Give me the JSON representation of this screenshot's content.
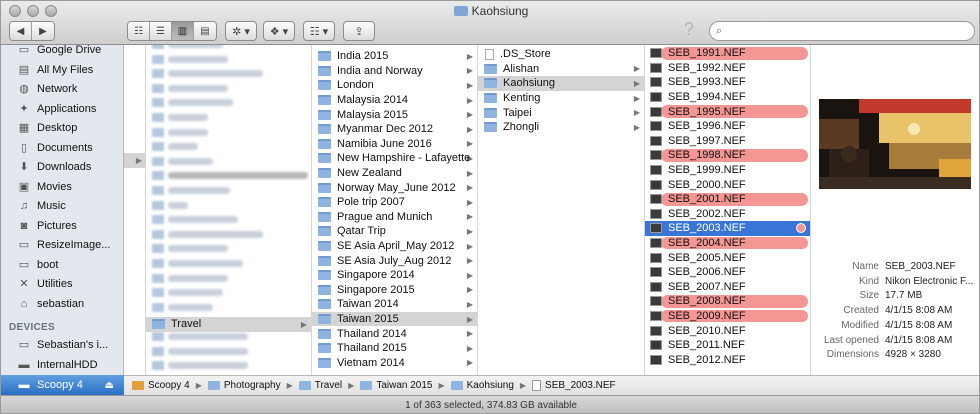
{
  "window": {
    "title": "Kaohsiung"
  },
  "toolbar": {
    "back": "◀",
    "forward": "▶",
    "view_icons": "☷",
    "view_list": "☰",
    "view_columns": "▥",
    "view_cover": "▤",
    "action": "✲ ▾",
    "dropbox": "❖ ▾",
    "arrange": "☷ ▾",
    "share": "⇪",
    "help": "?",
    "search_placeholder": ""
  },
  "sidebar": {
    "items": [
      {
        "label": "Google Drive",
        "icon": "folder-icon"
      },
      {
        "label": "All My Files",
        "icon": "files-icon"
      },
      {
        "label": "Network",
        "icon": "globe-icon"
      },
      {
        "label": "Applications",
        "icon": "applications-icon"
      },
      {
        "label": "Desktop",
        "icon": "desktop-icon"
      },
      {
        "label": "Documents",
        "icon": "documents-icon"
      },
      {
        "label": "Downloads",
        "icon": "downloads-icon"
      },
      {
        "label": "Movies",
        "icon": "movies-icon"
      },
      {
        "label": "Music",
        "icon": "music-icon"
      },
      {
        "label": "Pictures",
        "icon": "camera-icon"
      },
      {
        "label": "ResizeImage...",
        "icon": "folder-icon"
      },
      {
        "label": "boot",
        "icon": "folder-icon"
      },
      {
        "label": "Utilities",
        "icon": "utilities-icon"
      },
      {
        "label": "sebastian",
        "icon": "home-icon"
      }
    ],
    "devices_heading": "DEVICES",
    "devices": [
      {
        "label": "Sebastian's i...",
        "icon": "computer-icon"
      },
      {
        "label": "InternalHDD",
        "icon": "drive-icon"
      },
      {
        "label": "Scoopy 4",
        "icon": "external-drive-icon",
        "eject": "⏏"
      }
    ]
  },
  "columns": {
    "col2_selected": "Travel",
    "col3": [
      "India 2015",
      "India and Norway",
      "London",
      "Malaysia 2014",
      "Malaysia 2015",
      "Myanmar Dec 2012",
      "Namibia June 2016",
      "New Hampshire - Lafayette",
      "New Zealand",
      "Norway May_June 2012",
      "Pole trip 2007",
      "Prague and Munich",
      "Qatar Trip",
      "SE Asia April_May 2012",
      "SE Asia July_Aug 2012",
      "Singapore 2014",
      "Singapore 2015",
      "Taiwan 2014",
      "Taiwan 2015",
      "Thailand 2014",
      "Thailand 2015",
      "Vietnam 2014"
    ],
    "col3_selected": "Taiwan 2015",
    "col4": [
      ".DS_Store",
      "Alishan",
      "Kaohsiung",
      "Kenting",
      "Taipei",
      "Zhongli"
    ],
    "col4_selected": "Kaohsiung",
    "col5": [
      {
        "name": "SEB_1991.NEF",
        "tag": "red"
      },
      {
        "name": "SEB_1992.NEF",
        "tag": ""
      },
      {
        "name": "SEB_1993.NEF",
        "tag": ""
      },
      {
        "name": "SEB_1994.NEF",
        "tag": ""
      },
      {
        "name": "SEB_1995.NEF",
        "tag": "red"
      },
      {
        "name": "SEB_1996.NEF",
        "tag": ""
      },
      {
        "name": "SEB_1997.NEF",
        "tag": ""
      },
      {
        "name": "SEB_1998.NEF",
        "tag": "red"
      },
      {
        "name": "SEB_1999.NEF",
        "tag": ""
      },
      {
        "name": "SEB_2000.NEF",
        "tag": ""
      },
      {
        "name": "SEB_2001.NEF",
        "tag": "red"
      },
      {
        "name": "SEB_2002.NEF",
        "tag": ""
      },
      {
        "name": "SEB_2003.NEF",
        "tag": "selected"
      },
      {
        "name": "SEB_2004.NEF",
        "tag": "red"
      },
      {
        "name": "SEB_2005.NEF",
        "tag": ""
      },
      {
        "name": "SEB_2006.NEF",
        "tag": ""
      },
      {
        "name": "SEB_2007.NEF",
        "tag": ""
      },
      {
        "name": "SEB_2008.NEF",
        "tag": "red"
      },
      {
        "name": "SEB_2009.NEF",
        "tag": "red"
      },
      {
        "name": "SEB_2010.NEF",
        "tag": ""
      },
      {
        "name": "SEB_2011.NEF",
        "tag": ""
      },
      {
        "name": "SEB_2012.NEF",
        "tag": ""
      }
    ]
  },
  "preview": {
    "info": [
      {
        "key": "Name",
        "value": "SEB_2003.NEF"
      },
      {
        "key": "Kind",
        "value": "Nikon Electronic F..."
      },
      {
        "key": "Size",
        "value": "17.7 MB"
      },
      {
        "key": "Created",
        "value": "4/1/15 8:08 AM"
      },
      {
        "key": "Modified",
        "value": "4/1/15 8:08 AM"
      },
      {
        "key": "Last opened",
        "value": "4/1/15 8:08 AM"
      },
      {
        "key": "Dimensions",
        "value": "4928 × 3280"
      }
    ]
  },
  "pathbar": [
    "Scoopy 4",
    "Photography",
    "Travel",
    "Taiwan 2015",
    "Kaohsiung",
    "SEB_2003.NEF"
  ],
  "status": "1 of 363 selected, 374.83 GB available",
  "colors": {
    "selection_blue": "#3875d7",
    "red_tag": "#f49694",
    "sidebar_bg": "#e3e8ee"
  }
}
